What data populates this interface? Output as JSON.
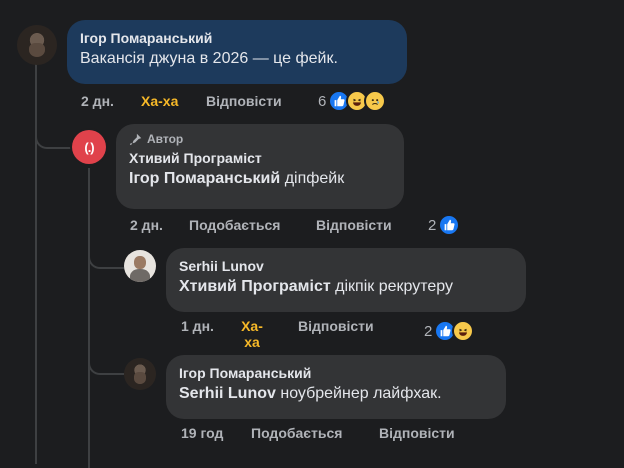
{
  "comments": [
    {
      "author": "Ігор Помаранський",
      "text": "Вакансія джуна в 2026 — це фейк.",
      "meta": {
        "time": "2 дн.",
        "like": "Ха-ха",
        "reply": "Відповісти"
      },
      "reaction_count": "6",
      "reactions": [
        "like-icon",
        "haha-icon",
        "sad-icon"
      ]
    },
    {
      "badge": "Автор",
      "author": "Хтивий Програміст",
      "mention": "Ігор Помаранський",
      "text": "діпфейк",
      "meta": {
        "time": "2 дн.",
        "like": "Подобається",
        "reply": "Відповісти"
      },
      "reaction_count": "2",
      "reactions": [
        "like-icon"
      ]
    },
    {
      "author": "Serhii Lunov",
      "mention": "Хтивий Програміст",
      "text": "дікпік рекрутеру",
      "meta": {
        "time": "1 дн.",
        "like": "Ха-ха",
        "reply": "Відповісти"
      },
      "reaction_count": "2",
      "reactions": [
        "like-icon",
        "haha-icon"
      ]
    },
    {
      "author": "Ігор Помаранський",
      "mention": "Serhii Lunov",
      "text": "ноубрейнер лайфхак.",
      "meta": {
        "time": "19 год",
        "like": "Подобається",
        "reply": "Відповісти"
      }
    }
  ],
  "author_avatar_text": "(.)",
  "colors": {
    "bubble": "#333436",
    "bubble_highlight": "#1d3a5c",
    "haha": "#f7b928",
    "like": "#1877f2",
    "author_badge_avatar": "#e0424b"
  }
}
